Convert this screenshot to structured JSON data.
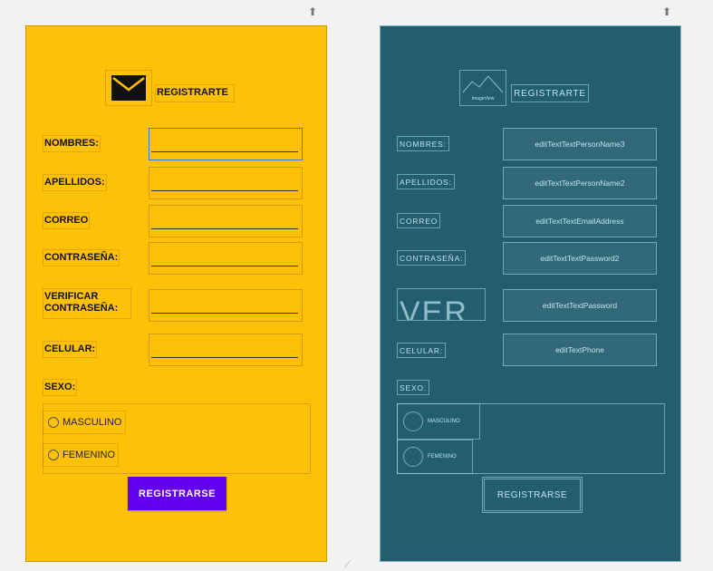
{
  "design": {
    "header": {
      "icon": "mail-icon",
      "title": "REGISTRARTE"
    },
    "fields": [
      {
        "label": "NOMBRES:"
      },
      {
        "label": "APELLIDOS:"
      },
      {
        "label": "CORREO"
      },
      {
        "label": "CONTRASEÑA:"
      },
      {
        "label_line1": "VERIFICAR",
        "label_line2": "CONTRASEÑA:"
      },
      {
        "label": "CELULAR:"
      }
    ],
    "sexo_label": "SEXO:",
    "radio": {
      "option1": "MASCULINO",
      "option2": "FEMENINO"
    },
    "submit_label": "REGISTRARSE"
  },
  "blueprint": {
    "image_view": "ImageView",
    "header_title": "REGISTRARTE",
    "labels": [
      "NOMBRES:",
      "APELLIDOS:",
      "CORREO",
      "CONTRASEÑA:",
      "VER",
      "CELULAR:"
    ],
    "inputs": [
      "editTextTextPersonName3",
      "editTextTextPersonName2",
      "editTextTextEmailAddress",
      "editTextTextPassword2",
      "editTextTextPassword",
      "editTextPhone"
    ],
    "sexo_label": "SEXO:",
    "radio": {
      "option1": "MASCULINO",
      "option2": "FEMENINO"
    },
    "submit_label": "REGISTRARSE"
  },
  "colors": {
    "design_bg": "#ffc107",
    "blueprint_bg": "#225e6e",
    "button": "#6200ee"
  }
}
